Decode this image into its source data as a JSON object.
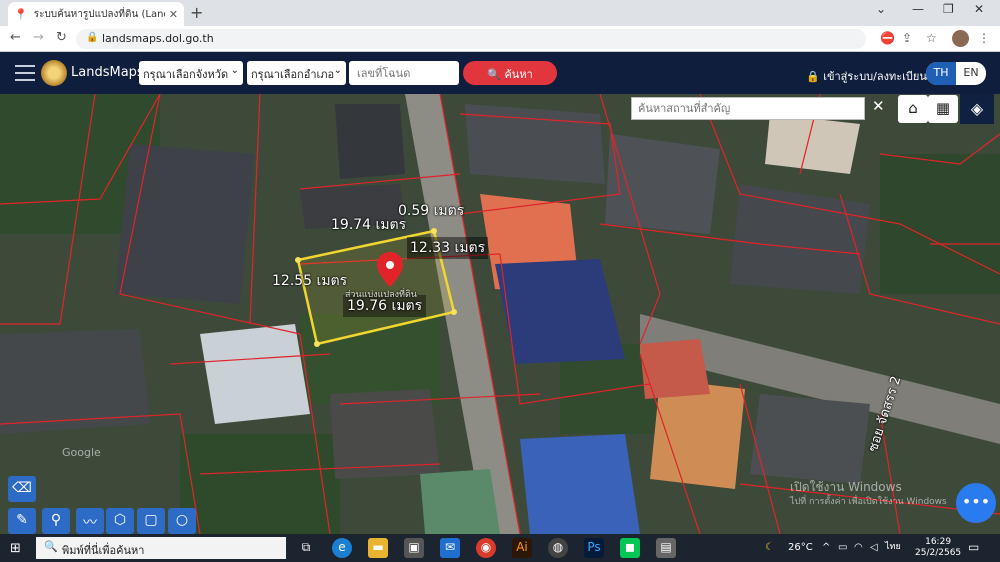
{
  "browser": {
    "tab_title": "ระบบค้นหารูปแปลงที่ดิน (LandsMaps",
    "tab_favicon": "map-pin-icon",
    "url": "landsmaps.dol.go.th"
  },
  "app": {
    "brand": "LandsMaps",
    "province_select": "กรุณาเลือกจังหวัด",
    "district_select": "กรุณาเลือกอำเภอ",
    "deed_placeholder": "เลขที่โฉนด",
    "search_label": "ค้นหา",
    "login_label": "เข้าสู่ระบบ/ลงทะเบียน",
    "lang_th": "TH",
    "lang_en": "EN",
    "accent": "#e2363f",
    "header_bg": "#0f1e3d"
  },
  "map": {
    "place_search_placeholder": "ค้นหาสถานที่สำคัญ",
    "measurements": {
      "top_left": "19.74 เมตร",
      "top_short": "0.59 เมตร",
      "right": "12.33 เมตร",
      "left": "12.55 เมตร",
      "bottom": "19.76 เมตร"
    },
    "parcel_label": "ส่วนแบ่งแปลงที่ดิน",
    "street_label": "ซอย จัดสรร 2",
    "watermark_line1": "เปิดใช้งาน Windows",
    "watermark_line2": "ไปที่ การตั้งค่า เพื่อเปิดใช้งาน Windows",
    "map_watermark": "Google"
  },
  "taskbar": {
    "search_placeholder": "พิมพ์ที่นี่เพื่อค้นหา",
    "weather": "26°C",
    "keyboard": "ไทย",
    "time": "16:29",
    "date": "25/2/2565"
  }
}
